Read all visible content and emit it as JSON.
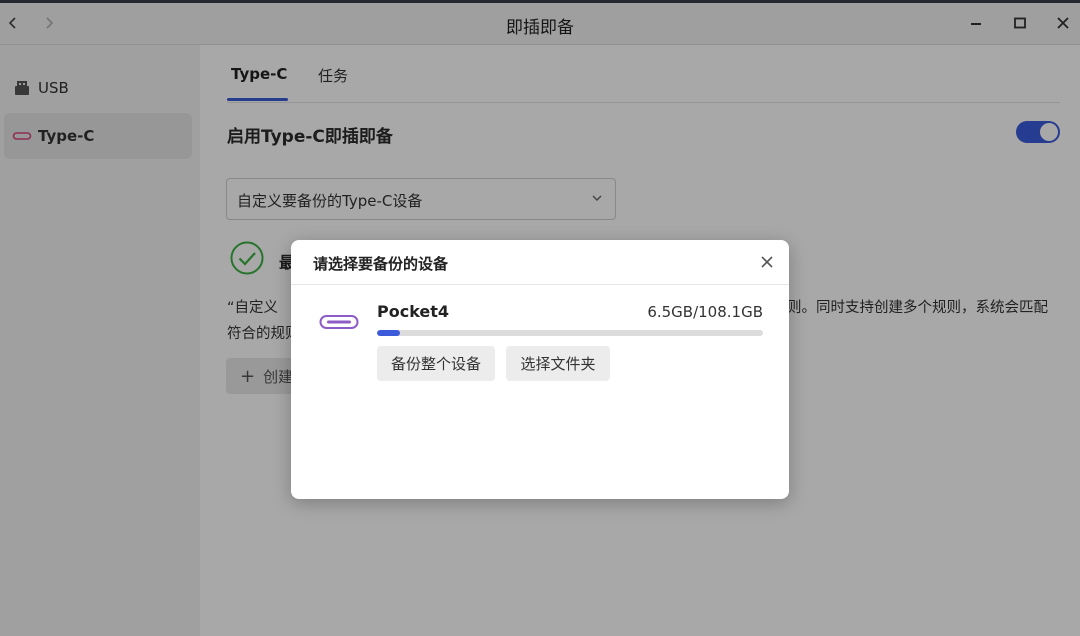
{
  "window": {
    "title": "即插即备"
  },
  "sidebar": {
    "items": [
      {
        "label": "USB",
        "icon": "usb-drive-icon",
        "active": false
      },
      {
        "label": "Type-C",
        "icon": "type-c-icon",
        "active": true
      }
    ]
  },
  "tabs": [
    {
      "label": "Type-C",
      "active": true
    },
    {
      "label": "任务",
      "active": false
    }
  ],
  "settings": {
    "enable_label": "启用Type-C即插即备",
    "enabled": true,
    "device_select_value": "自定义要备份的Type-C设备",
    "status_text": "最",
    "description_line1_left": "“自定义",
    "description_line1_right": "则。同时支持创建多个规则，系统会匹配",
    "description_line2_left": "符合的规则",
    "create_button_label": "创建"
  },
  "dialog": {
    "title": "请选择要备份的设备",
    "device": {
      "name": "Pocket4",
      "size_text": "6.5GB/108.1GB",
      "used_fraction": 0.06
    },
    "buttons": {
      "backup_whole": "备份整个设备",
      "select_folder": "选择文件夹"
    }
  },
  "colors": {
    "accent": "#3b5bdb",
    "success": "#3cb043",
    "type_c_icon": "#8e5cc7",
    "type_c_icon_sidebar": "#d9467f"
  }
}
